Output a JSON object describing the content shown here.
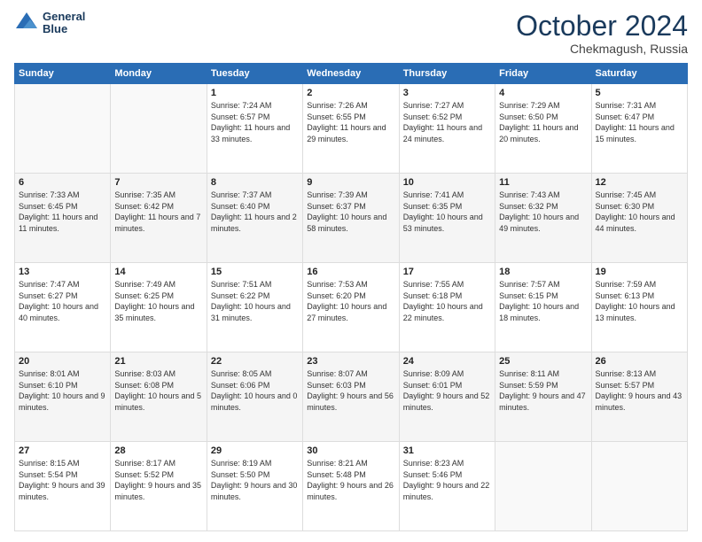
{
  "header": {
    "logo_line1": "General",
    "logo_line2": "Blue",
    "month": "October 2024",
    "location": "Chekmagush, Russia"
  },
  "weekdays": [
    "Sunday",
    "Monday",
    "Tuesday",
    "Wednesday",
    "Thursday",
    "Friday",
    "Saturday"
  ],
  "weeks": [
    [
      {
        "day": "",
        "sunrise": "",
        "sunset": "",
        "daylight": ""
      },
      {
        "day": "",
        "sunrise": "",
        "sunset": "",
        "daylight": ""
      },
      {
        "day": "1",
        "sunrise": "Sunrise: 7:24 AM",
        "sunset": "Sunset: 6:57 PM",
        "daylight": "Daylight: 11 hours and 33 minutes."
      },
      {
        "day": "2",
        "sunrise": "Sunrise: 7:26 AM",
        "sunset": "Sunset: 6:55 PM",
        "daylight": "Daylight: 11 hours and 29 minutes."
      },
      {
        "day": "3",
        "sunrise": "Sunrise: 7:27 AM",
        "sunset": "Sunset: 6:52 PM",
        "daylight": "Daylight: 11 hours and 24 minutes."
      },
      {
        "day": "4",
        "sunrise": "Sunrise: 7:29 AM",
        "sunset": "Sunset: 6:50 PM",
        "daylight": "Daylight: 11 hours and 20 minutes."
      },
      {
        "day": "5",
        "sunrise": "Sunrise: 7:31 AM",
        "sunset": "Sunset: 6:47 PM",
        "daylight": "Daylight: 11 hours and 15 minutes."
      }
    ],
    [
      {
        "day": "6",
        "sunrise": "Sunrise: 7:33 AM",
        "sunset": "Sunset: 6:45 PM",
        "daylight": "Daylight: 11 hours and 11 minutes."
      },
      {
        "day": "7",
        "sunrise": "Sunrise: 7:35 AM",
        "sunset": "Sunset: 6:42 PM",
        "daylight": "Daylight: 11 hours and 7 minutes."
      },
      {
        "day": "8",
        "sunrise": "Sunrise: 7:37 AM",
        "sunset": "Sunset: 6:40 PM",
        "daylight": "Daylight: 11 hours and 2 minutes."
      },
      {
        "day": "9",
        "sunrise": "Sunrise: 7:39 AM",
        "sunset": "Sunset: 6:37 PM",
        "daylight": "Daylight: 10 hours and 58 minutes."
      },
      {
        "day": "10",
        "sunrise": "Sunrise: 7:41 AM",
        "sunset": "Sunset: 6:35 PM",
        "daylight": "Daylight: 10 hours and 53 minutes."
      },
      {
        "day": "11",
        "sunrise": "Sunrise: 7:43 AM",
        "sunset": "Sunset: 6:32 PM",
        "daylight": "Daylight: 10 hours and 49 minutes."
      },
      {
        "day": "12",
        "sunrise": "Sunrise: 7:45 AM",
        "sunset": "Sunset: 6:30 PM",
        "daylight": "Daylight: 10 hours and 44 minutes."
      }
    ],
    [
      {
        "day": "13",
        "sunrise": "Sunrise: 7:47 AM",
        "sunset": "Sunset: 6:27 PM",
        "daylight": "Daylight: 10 hours and 40 minutes."
      },
      {
        "day": "14",
        "sunrise": "Sunrise: 7:49 AM",
        "sunset": "Sunset: 6:25 PM",
        "daylight": "Daylight: 10 hours and 35 minutes."
      },
      {
        "day": "15",
        "sunrise": "Sunrise: 7:51 AM",
        "sunset": "Sunset: 6:22 PM",
        "daylight": "Daylight: 10 hours and 31 minutes."
      },
      {
        "day": "16",
        "sunrise": "Sunrise: 7:53 AM",
        "sunset": "Sunset: 6:20 PM",
        "daylight": "Daylight: 10 hours and 27 minutes."
      },
      {
        "day": "17",
        "sunrise": "Sunrise: 7:55 AM",
        "sunset": "Sunset: 6:18 PM",
        "daylight": "Daylight: 10 hours and 22 minutes."
      },
      {
        "day": "18",
        "sunrise": "Sunrise: 7:57 AM",
        "sunset": "Sunset: 6:15 PM",
        "daylight": "Daylight: 10 hours and 18 minutes."
      },
      {
        "day": "19",
        "sunrise": "Sunrise: 7:59 AM",
        "sunset": "Sunset: 6:13 PM",
        "daylight": "Daylight: 10 hours and 13 minutes."
      }
    ],
    [
      {
        "day": "20",
        "sunrise": "Sunrise: 8:01 AM",
        "sunset": "Sunset: 6:10 PM",
        "daylight": "Daylight: 10 hours and 9 minutes."
      },
      {
        "day": "21",
        "sunrise": "Sunrise: 8:03 AM",
        "sunset": "Sunset: 6:08 PM",
        "daylight": "Daylight: 10 hours and 5 minutes."
      },
      {
        "day": "22",
        "sunrise": "Sunrise: 8:05 AM",
        "sunset": "Sunset: 6:06 PM",
        "daylight": "Daylight: 10 hours and 0 minutes."
      },
      {
        "day": "23",
        "sunrise": "Sunrise: 8:07 AM",
        "sunset": "Sunset: 6:03 PM",
        "daylight": "Daylight: 9 hours and 56 minutes."
      },
      {
        "day": "24",
        "sunrise": "Sunrise: 8:09 AM",
        "sunset": "Sunset: 6:01 PM",
        "daylight": "Daylight: 9 hours and 52 minutes."
      },
      {
        "day": "25",
        "sunrise": "Sunrise: 8:11 AM",
        "sunset": "Sunset: 5:59 PM",
        "daylight": "Daylight: 9 hours and 47 minutes."
      },
      {
        "day": "26",
        "sunrise": "Sunrise: 8:13 AM",
        "sunset": "Sunset: 5:57 PM",
        "daylight": "Daylight: 9 hours and 43 minutes."
      }
    ],
    [
      {
        "day": "27",
        "sunrise": "Sunrise: 8:15 AM",
        "sunset": "Sunset: 5:54 PM",
        "daylight": "Daylight: 9 hours and 39 minutes."
      },
      {
        "day": "28",
        "sunrise": "Sunrise: 8:17 AM",
        "sunset": "Sunset: 5:52 PM",
        "daylight": "Daylight: 9 hours and 35 minutes."
      },
      {
        "day": "29",
        "sunrise": "Sunrise: 8:19 AM",
        "sunset": "Sunset: 5:50 PM",
        "daylight": "Daylight: 9 hours and 30 minutes."
      },
      {
        "day": "30",
        "sunrise": "Sunrise: 8:21 AM",
        "sunset": "Sunset: 5:48 PM",
        "daylight": "Daylight: 9 hours and 26 minutes."
      },
      {
        "day": "31",
        "sunrise": "Sunrise: 8:23 AM",
        "sunset": "Sunset: 5:46 PM",
        "daylight": "Daylight: 9 hours and 22 minutes."
      },
      {
        "day": "",
        "sunrise": "",
        "sunset": "",
        "daylight": ""
      },
      {
        "day": "",
        "sunrise": "",
        "sunset": "",
        "daylight": ""
      }
    ]
  ]
}
